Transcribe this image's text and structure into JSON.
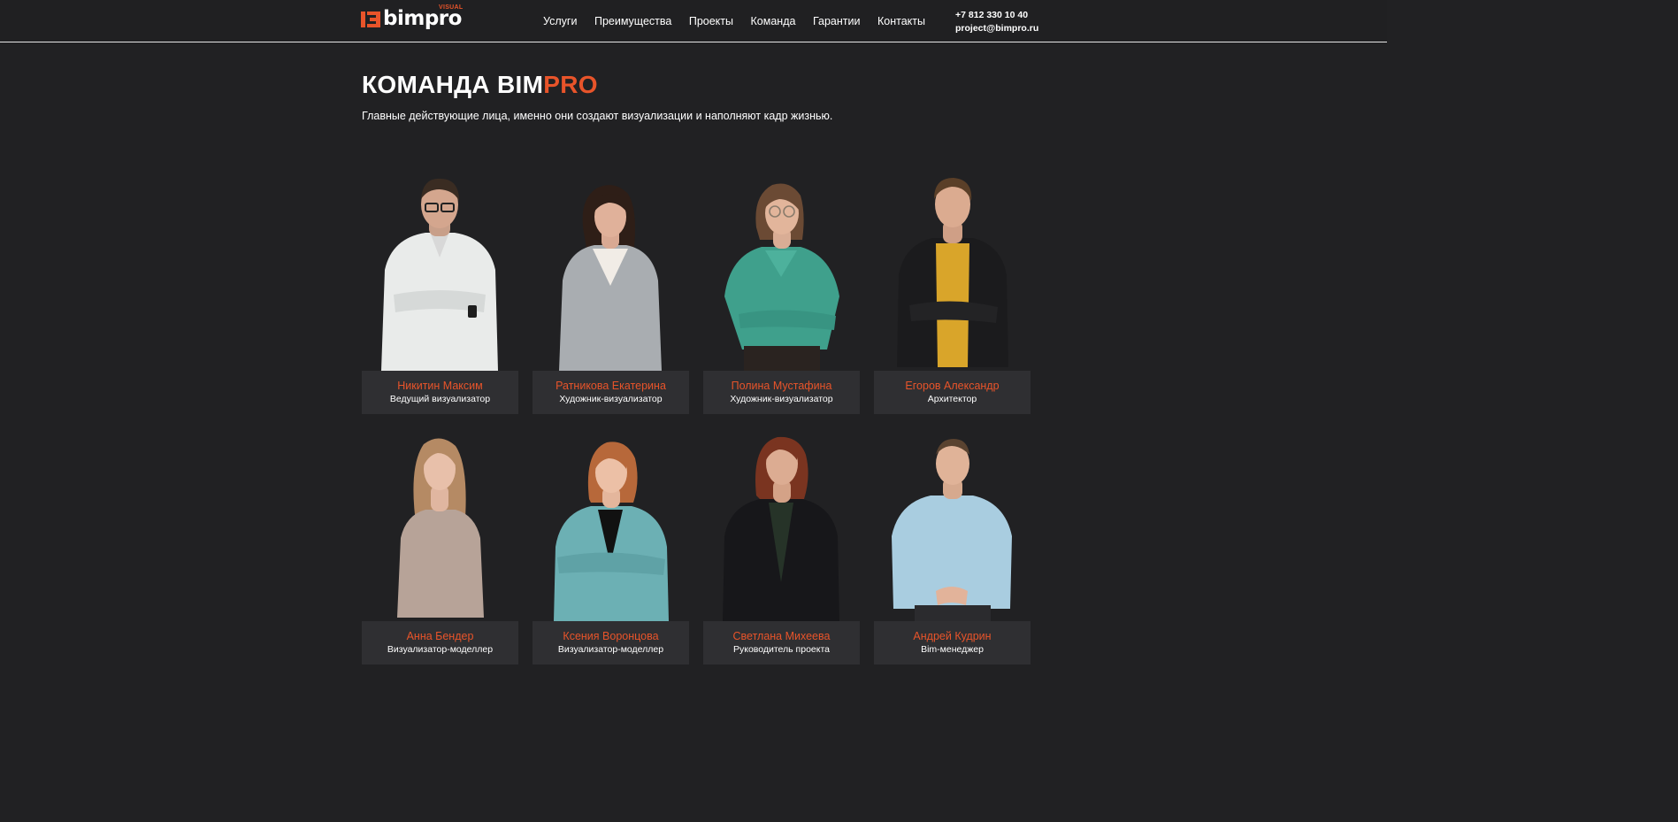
{
  "header": {
    "logo_text": "bimpro",
    "logo_sup": "VISUAL",
    "nav": [
      "Услуги",
      "Преимущества",
      "Проекты",
      "Команда",
      "Гарантии",
      "Контакты"
    ],
    "phone": "+7 812 330 10 40",
    "email": "project@bimpro.ru"
  },
  "section": {
    "title_main": "КОМАНДА BIM",
    "title_accent": "PRO",
    "subtitle": "Главные действующие лица, именно они создают визуализации и наполняют кадр жизнью."
  },
  "colors": {
    "accent": "#e8542a",
    "background": "#212123",
    "plate": "#2f2f32"
  },
  "team": [
    {
      "name": "Никитин Максим",
      "role": "Ведущий визуализатор",
      "icon": "person-photo"
    },
    {
      "name": "Ратникова Екатерина",
      "role": "Художник-визуализатор",
      "icon": "person-photo"
    },
    {
      "name": "Полина Мустафина",
      "role": "Художник-визуализатор",
      "icon": "person-photo"
    },
    {
      "name": "Егоров Александр",
      "role": "Архитектор",
      "icon": "person-photo"
    },
    {
      "name": "Анна Бендер",
      "role": "Визуализатор-моделлер",
      "icon": "person-photo"
    },
    {
      "name": "Ксения Воронцова",
      "role": "Визуализатор-моделлер",
      "icon": "person-photo"
    },
    {
      "name": "Светлана Михеева",
      "role": "Руководитель проекта",
      "icon": "person-photo"
    },
    {
      "name": "Андрей Кудрин",
      "role": "Bim-менеджер",
      "icon": "person-photo"
    }
  ]
}
